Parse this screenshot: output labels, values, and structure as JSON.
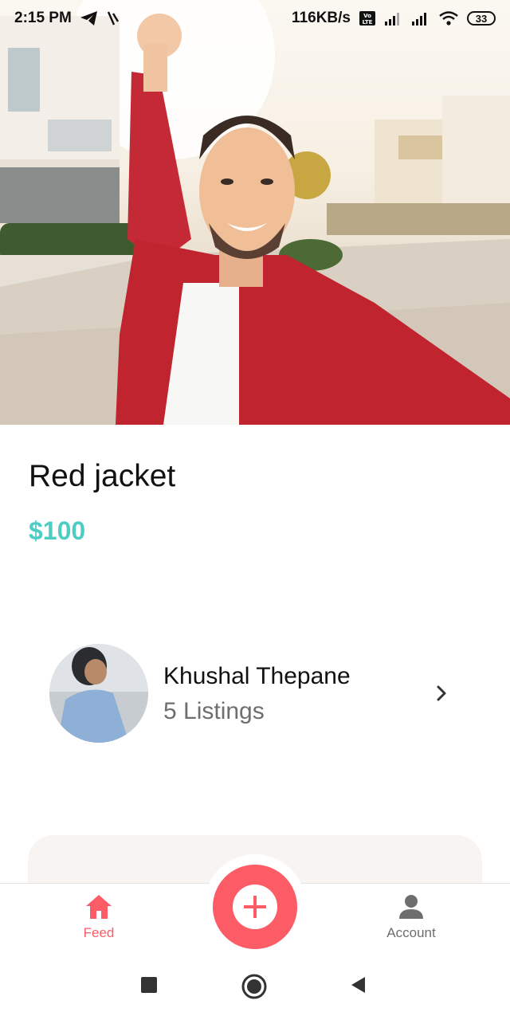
{
  "status_bar": {
    "time": "2:15 PM",
    "network_speed": "116KB/s",
    "battery": "33",
    "icons": [
      "telegram-icon",
      "signal-wave-icon",
      "volte-icon",
      "cell-signal-icon",
      "cell-signal-icon",
      "wifi-icon",
      "battery-icon"
    ]
  },
  "listing": {
    "title": "Red jacket",
    "price": "$100"
  },
  "seller": {
    "name": "Khushal Thepane",
    "listings": "5 Listings"
  },
  "bottom_nav": {
    "feed_label": "Feed",
    "account_label": "Account",
    "add_icon": "plus-icon"
  },
  "colors": {
    "primary": "#fc5c65",
    "secondary": "#4ecdc4",
    "medium": "#6e6e6e",
    "light": "#f7f4f2"
  },
  "system_nav": [
    "square-icon",
    "circle-icon",
    "back-triangle-icon"
  ]
}
